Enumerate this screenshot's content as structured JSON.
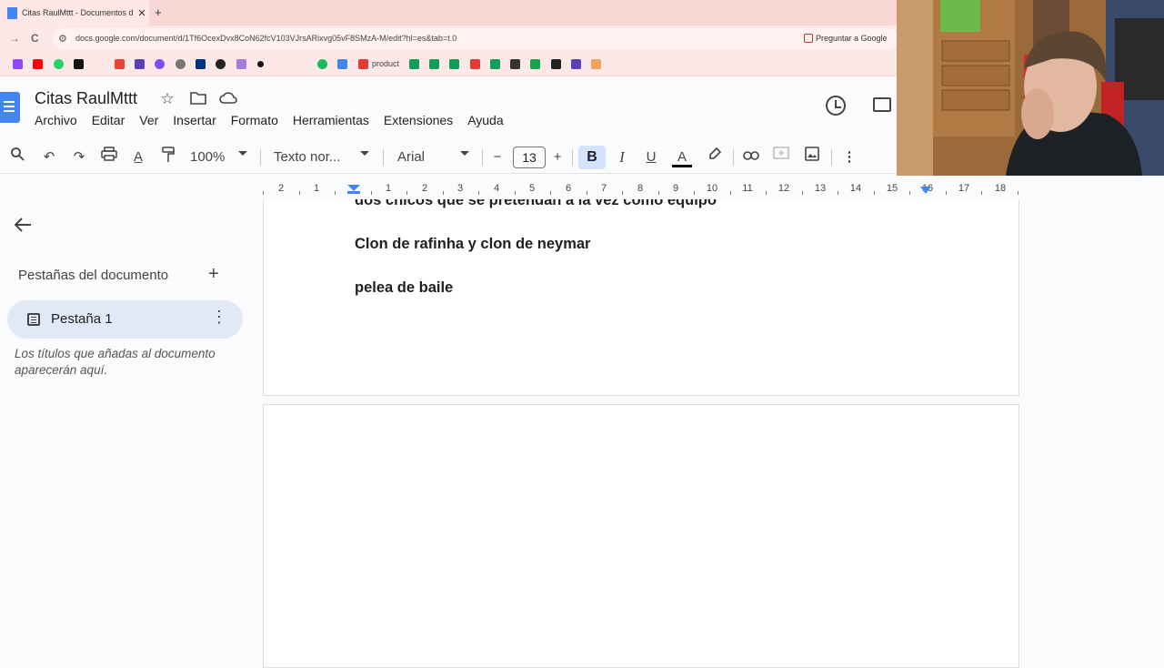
{
  "browser": {
    "tab_title": "Citas RaulMttt - Documentos d",
    "tab_close": "✕",
    "new_tab": "+",
    "back": "→",
    "reload": "C",
    "url": "docs.google.com/document/d/1Tf6OcexDvx8CoN62fcV103VJrsARixvg05vF8SMzA-M/edit?hl=es&tab=t.0",
    "ask_google": "Preguntar a Google",
    "bookmark_text": "product"
  },
  "docs": {
    "title": "Citas RaulMttt",
    "menu": [
      "Archivo",
      "Editar",
      "Ver",
      "Insertar",
      "Formato",
      "Herramientas",
      "Extensiones",
      "Ayuda"
    ]
  },
  "toolbar": {
    "zoom": "100%",
    "style": "Texto nor...",
    "font": "Arial",
    "font_size": "13",
    "minus": "−",
    "plus": "+",
    "bold": "B",
    "italic": "I",
    "underline": "U",
    "text_color": "A"
  },
  "ruler": {
    "labels": [
      "2",
      "1",
      "1",
      "2",
      "3",
      "4",
      "5",
      "6",
      "7",
      "8",
      "9",
      "10",
      "11",
      "12",
      "13",
      "14",
      "15",
      "16",
      "17",
      "18"
    ]
  },
  "sidebar": {
    "tabs_label": "Pestañas del documento",
    "tab_name": "Pestaña 1",
    "hint": "Los títulos que añadas al documento aparecerán aquí."
  },
  "document": {
    "lines": [
      "dos chicos que se pretendan a la vez como equipo",
      "Clon de rafinha y clon de neymar",
      "pelea de baile"
    ]
  },
  "colors": {
    "accent": "#4285f4",
    "bold_active": "#d3e3fd",
    "chrome_bg": "#fce8e6"
  }
}
